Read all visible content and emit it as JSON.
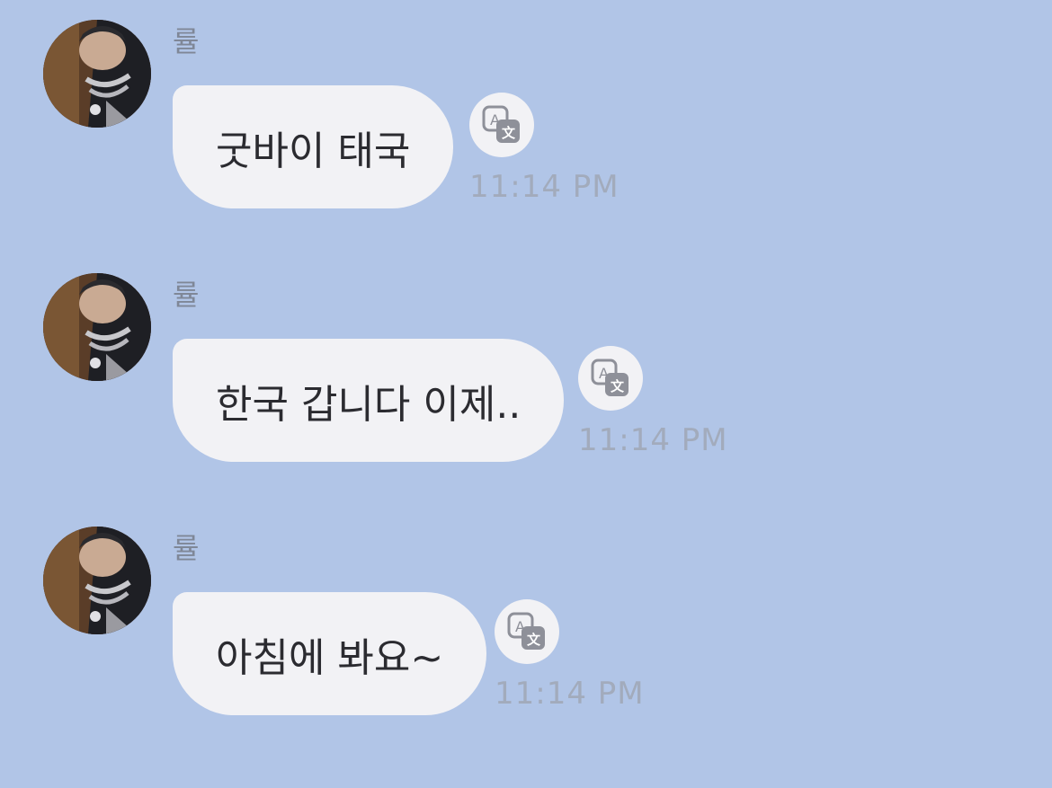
{
  "messages": [
    {
      "sender": "률",
      "text": "굿바이 태국",
      "time": "11:14 PM",
      "avatar_icon": "profile-photo",
      "translate_icon": "translate-icon"
    },
    {
      "sender": "률",
      "text": "한국 갑니다 이제..",
      "time": "11:14 PM",
      "avatar_icon": "profile-photo",
      "translate_icon": "translate-icon"
    },
    {
      "sender": "률",
      "text": "아침에 봐요~",
      "time": "11:14 PM",
      "avatar_icon": "profile-photo",
      "translate_icon": "translate-icon"
    }
  ],
  "colors": {
    "background": "#b1c5e7",
    "bubble": "#f2f2f5",
    "message_text": "#2b2b30",
    "sender_text": "#7f8797",
    "time_text": "#a2abbc"
  }
}
